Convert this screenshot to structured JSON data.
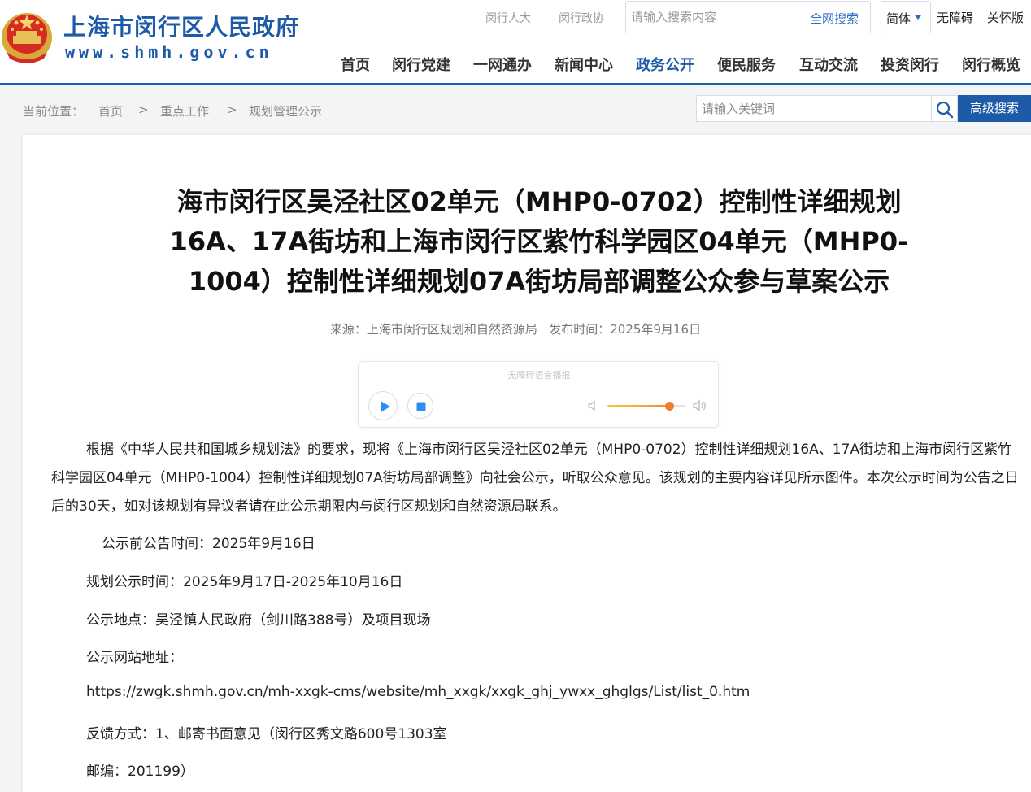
{
  "header": {
    "site_name": "上海市闵行区人民政府",
    "site_domain": "www.shmh.gov.cn",
    "top_links": [
      "闵行人大",
      "闵行政协"
    ],
    "search": {
      "placeholder": "请输入搜索内容",
      "button": "全网搜索"
    },
    "language": "简体",
    "accessibility": "无障碍",
    "elderly_mode": "关怀版",
    "nav": [
      {
        "label": "首页"
      },
      {
        "label": "闵行党建"
      },
      {
        "label": "一网通办"
      },
      {
        "label": "新闻中心"
      },
      {
        "label": "政务公开",
        "active": true
      },
      {
        "label": "便民服务"
      },
      {
        "label": "互动交流"
      },
      {
        "label": "投资闵行"
      },
      {
        "label": "闵行概览"
      }
    ],
    "accent_color": "#1d5aa8"
  },
  "breadcrumb": {
    "prefix": "当前位置：",
    "items": [
      "首页",
      "重点工作",
      "规划管理公示"
    ],
    "separator": ">"
  },
  "site_search": {
    "placeholder": "请输入关键词",
    "advanced_button": "高级搜索"
  },
  "article": {
    "title": "海市闵行区吴泾社区02单元（MHP0-0702）控制性详细规划16A、17A街坊和上海市闵行区紫竹科学园区04单元（MHP0-1004）控制性详细规划07A街坊局部调整公众参与草案公示",
    "source": "来源：上海市闵行区规划和自然资源局",
    "published": "发布时间：2025年9月16日",
    "audio_player": {
      "label": "无障碍语音播报",
      "volume_fraction": 0.8
    },
    "body": "根据《中华人民共和国城乡规划法》的要求，现将《上海市闵行区吴泾社区02单元（MHP0-0702）控制性详细规划16A、17A街坊和上海市闵行区紫竹科学园区04单元（MHP0-1004）控制性详细规划07A街坊局部调整》向社会公示，听取公众意见。该规划的主要内容详见所示图件。本次公示时间为公告之日后的30天，如对该规划有异议者请在此公示期限内与闵行区规划和自然资源局联系。",
    "lines": [
      "公示前公告时间：2025年9月16日",
      "规划公示时间：2025年9月17日-2025年10月16日",
      "公示地点：吴泾镇人民政府（剑川路388号）及项目现场",
      "公示网站地址：",
      "https://zwgk.shmh.gov.cn/mh-xxgk-cms/website/mh_xxgk/xxgk_ghj_ywxx_ghglgs/List/list_0.htm",
      "反馈方式：1、邮寄书面意见（闵行区秀文路600号1303室",
      "邮编：201199）"
    ]
  }
}
